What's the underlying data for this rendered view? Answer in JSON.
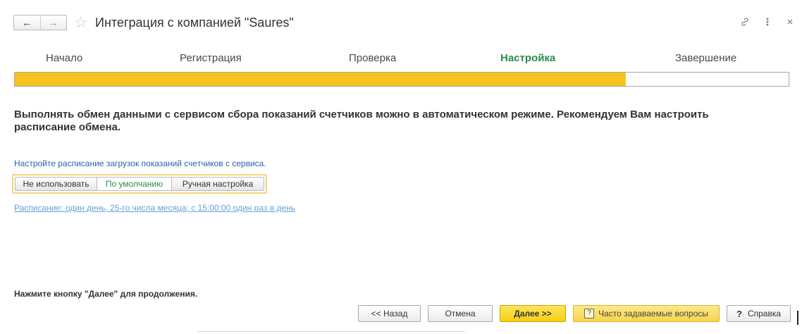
{
  "window": {
    "title": "Интеграция с компанией \"Saures\"",
    "nav": {
      "back": "←",
      "forward": "→"
    },
    "star": "☆",
    "icons": [
      "link-icon",
      "more-icon",
      "close-icon"
    ]
  },
  "steps": [
    {
      "label": "Начало",
      "active": false
    },
    {
      "label": "Регистрация",
      "active": false
    },
    {
      "label": "Проверка",
      "active": false
    },
    {
      "label": "Настройка",
      "active": true
    },
    {
      "label": "Завершение",
      "active": false
    }
  ],
  "progress": {
    "fraction": 0.79,
    "color": "#f7c41f"
  },
  "content": {
    "lead": "Выполнять обмен данными с сервисом сбора показаний счетчиков можно в автоматическом режиме. Рекомендуем Вам настроить расписание обмена.",
    "hint": "Настройте расписание загрузок показаний счетчиков с сервиса.",
    "schedule_options": [
      "Не использовать",
      "По умолчанию",
      "Ручная настройка"
    ],
    "selected_option": "По умолчанию",
    "schedule_link": "Расписание: один день, 25-го числа месяца; с 15:00:00 один раз в день",
    "footer_note": "Нажмите кнопку \"Далее\" для продолжения."
  },
  "buttons": {
    "back": "<< Назад",
    "cancel": "Отмена",
    "next": "Далее >>",
    "faq": "Часто задаваемые вопросы",
    "help": "Справка"
  },
  "colors": {
    "accent_green": "#2a8c4a",
    "link_blue": "#2d5faa",
    "primary_yellow": "#f5cf14"
  }
}
